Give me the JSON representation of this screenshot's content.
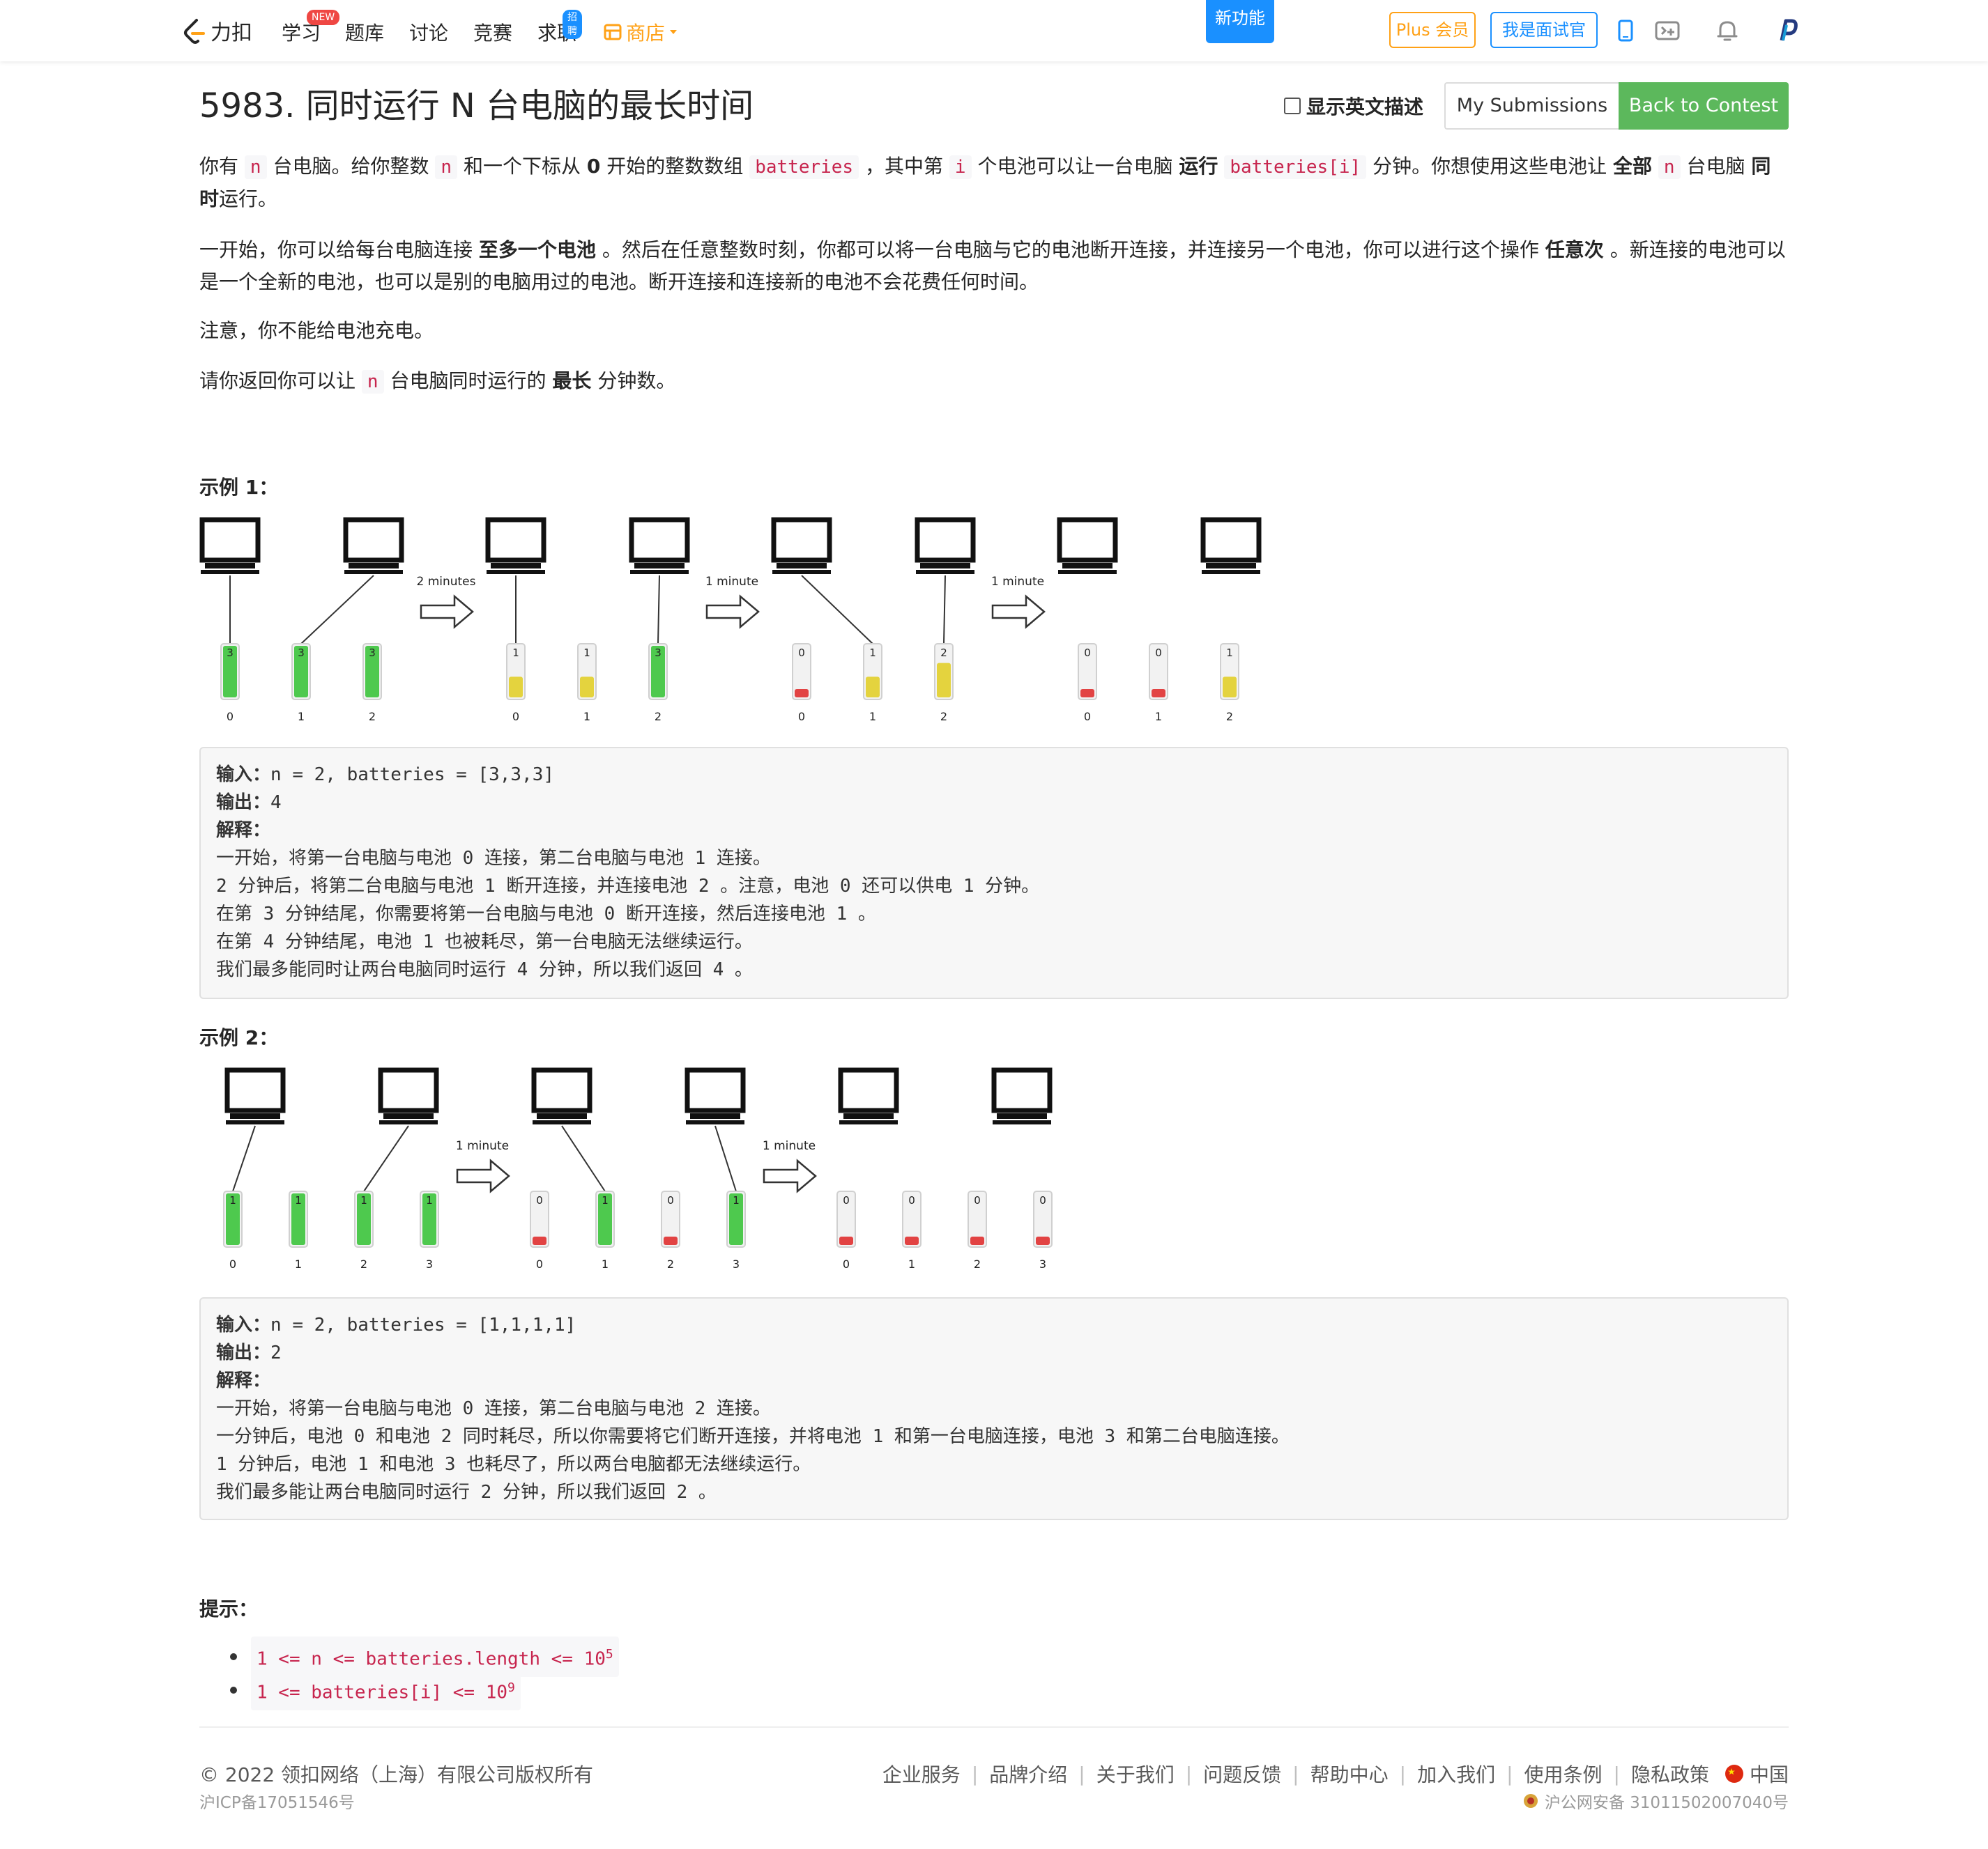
{
  "nav": {
    "logo_text": "力扣",
    "items": [
      {
        "label": "学习",
        "badge": "NEW"
      },
      {
        "label": "题库"
      },
      {
        "label": "讨论"
      },
      {
        "label": "竞赛"
      },
      {
        "label": "求职",
        "badge": "招聘"
      }
    ],
    "store_label": "商店",
    "new_feature": "新功能",
    "plus_label": "Plus 会员",
    "interviewer_label": "我是面试官"
  },
  "header": {
    "title": "5983. 同时运行 N 台电脑的最长时间",
    "show_english_label": "显示英文描述",
    "my_submissions": "My Submissions",
    "back_to_contest": "Back to Contest"
  },
  "problem": {
    "p1": {
      "t1": "你有",
      "c1": "n",
      "t2": "台电脑。给你整数",
      "c2": "n",
      "t3": "和一个下标从",
      "b1": "0",
      "t4": "开始的整数数组",
      "c3": "batteries",
      "t5": "，其中第",
      "c4": "i",
      "t6": "个电池可以让一台电脑",
      "b2": "运行",
      "c5": "batteries[i]",
      "t7": "分钟。你想使用这些电池让",
      "b3": "全部",
      "c6": "n",
      "t8": "台电脑",
      "b4": "同时",
      "t9": "运行。"
    },
    "p2": {
      "t1": "一开始，你可以给每台电脑连接",
      "b1": "至多一个电池",
      "t2": "。然后在任意整数时刻，你都可以将一台电脑与它的电池断开连接，并连接另一个电池，你可以进行这个操作",
      "b2": "任意次",
      "t3": "。新连接的电池可以是一个全新的电池，也可以是别的电脑用过的电池。断开连接和连接新的电池不会花费任何时间。"
    },
    "p3": "注意，你不能给电池充电。",
    "p4": {
      "t1": "请你返回你可以让",
      "c1": "n",
      "t2": "台电脑同时运行的",
      "b1": "最长",
      "t3": "分钟数。"
    }
  },
  "example1": {
    "title": "示例 1：",
    "figure": {
      "arrows": [
        "2 minutes",
        "1 minute",
        "1 minute"
      ],
      "stages": [
        {
          "batteries": [
            3,
            3,
            3
          ],
          "indices": [
            "0",
            "1",
            "2"
          ]
        },
        {
          "batteries": [
            1,
            1,
            3
          ],
          "indices": [
            "0",
            "1",
            "2"
          ]
        },
        {
          "batteries": [
            0,
            1,
            2
          ],
          "indices": [
            "0",
            "1",
            "2"
          ]
        },
        {
          "batteries": [
            0,
            0,
            1
          ],
          "indices": [
            "0",
            "1",
            "2"
          ]
        }
      ]
    },
    "input_label": "输入：",
    "input_value": "n = 2, batteries = [3,3,3]",
    "output_label": "输出：",
    "output_value": "4",
    "explain_label": "解释：",
    "explain_lines": [
      "一开始，将第一台电脑与电池 0 连接，第二台电脑与电池 1 连接。",
      "2 分钟后，将第二台电脑与电池 1 断开连接，并连接电池 2 。注意，电池 0 还可以供电 1 分钟。",
      "在第 3 分钟结尾，你需要将第一台电脑与电池 0 断开连接，然后连接电池 1 。",
      "在第 4 分钟结尾，电池 1 也被耗尽，第一台电脑无法继续运行。",
      "我们最多能同时让两台电脑同时运行 4 分钟，所以我们返回 4 。"
    ]
  },
  "example2": {
    "title": "示例 2：",
    "figure": {
      "arrows": [
        "1 minute",
        "1 minute"
      ],
      "stages": [
        {
          "batteries": [
            1,
            1,
            1,
            1
          ],
          "indices": [
            "0",
            "1",
            "2",
            "3"
          ]
        },
        {
          "batteries": [
            0,
            1,
            0,
            1
          ],
          "indices": [
            "0",
            "1",
            "2",
            "3"
          ]
        },
        {
          "batteries": [
            0,
            0,
            0,
            0
          ],
          "indices": [
            "0",
            "1",
            "2",
            "3"
          ]
        }
      ]
    },
    "input_label": "输入：",
    "input_value": "n = 2, batteries = [1,1,1,1]",
    "output_label": "输出：",
    "output_value": "2",
    "explain_label": "解释：",
    "explain_lines": [
      "一开始，将第一台电脑与电池 0 连接，第二台电脑与电池 2 连接。",
      "一分钟后，电池 0 和电池 2 同时耗尽，所以你需要将它们断开连接，并将电池 1 和第一台电脑连接，电池 3 和第二台电脑连接。",
      "1 分钟后，电池 1 和电池 3 也耗尽了，所以两台电脑都无法继续运行。",
      "我们最多能让两台电脑同时运行 2 分钟，所以我们返回 2 。"
    ]
  },
  "hints": {
    "title": "提示：",
    "items": [
      {
        "text": "1 <= n <= batteries.length <= 10",
        "sup": "5"
      },
      {
        "text": "1 <= batteries[i] <= 10",
        "sup": "9"
      }
    ]
  },
  "footer": {
    "copyright": "© 2022 领扣网络（上海）有限公司版权所有",
    "icp": "沪ICP备17051546号",
    "links": [
      "企业服务",
      "品牌介绍",
      "关于我们",
      "问题反馈",
      "帮助中心",
      "加入我们",
      "使用条例",
      "隐私政策"
    ],
    "region": "中国",
    "police": "沪公网安备 31011502007040号"
  },
  "colors": {
    "brand_orange": "#ffa116",
    "link_blue": "#1a90ff",
    "success_green": "#5cb85c",
    "code_red": "#c7254e",
    "battery_full": "#3cc43c",
    "battery_half": "#e2cf2a",
    "battery_empty": "#e03030"
  }
}
